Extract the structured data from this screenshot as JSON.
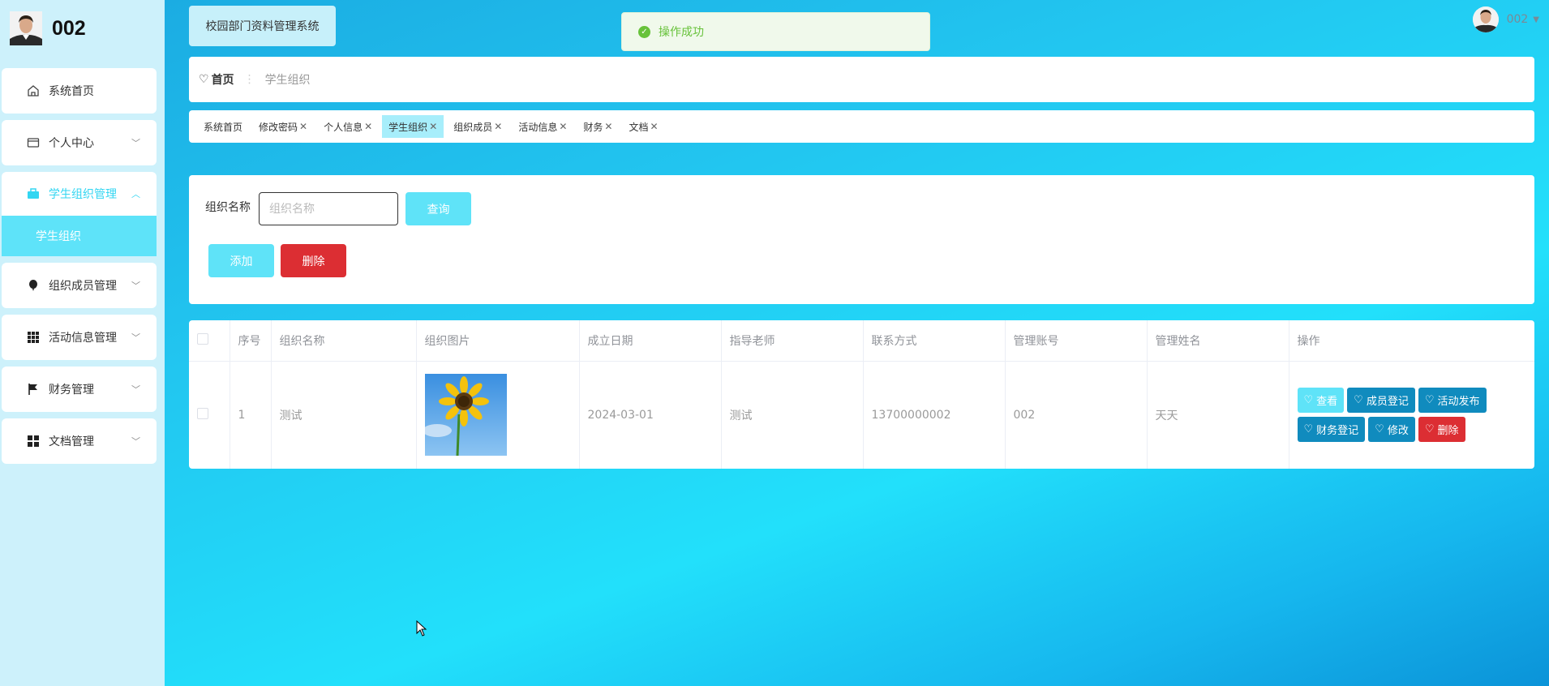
{
  "sidebar": {
    "brand": "002",
    "items": [
      {
        "label": "系统首页",
        "icon": "home-icon"
      },
      {
        "label": "个人中心",
        "icon": "card-icon"
      },
      {
        "label": "学生组织管理",
        "icon": "briefcase-icon",
        "active": true
      },
      {
        "label": "组织成员管理",
        "icon": "balloon-icon"
      },
      {
        "label": "活动信息管理",
        "icon": "grid-icon"
      },
      {
        "label": "财务管理",
        "icon": "flag-icon"
      },
      {
        "label": "文档管理",
        "icon": "apps-icon"
      }
    ],
    "submenu": "学生组织"
  },
  "header": {
    "system_title": "校园部门资料管理系统",
    "toast": "操作成功",
    "user": "002"
  },
  "breadcrumb": {
    "home": "首页",
    "current": "学生组织"
  },
  "tags": [
    {
      "label": "系统首页",
      "closable": false
    },
    {
      "label": "修改密码",
      "closable": true
    },
    {
      "label": "个人信息",
      "closable": true
    },
    {
      "label": "学生组织",
      "closable": true,
      "active": true
    },
    {
      "label": "组织成员",
      "closable": true
    },
    {
      "label": "活动信息",
      "closable": true
    },
    {
      "label": "财务",
      "closable": true
    },
    {
      "label": "文档",
      "closable": true
    }
  ],
  "search": {
    "label": "组织名称",
    "placeholder": "组织名称",
    "query_button": "查询",
    "add_button": "添加",
    "delete_button": "删除"
  },
  "table": {
    "headers": [
      "序号",
      "组织名称",
      "组织图片",
      "成立日期",
      "指导老师",
      "联系方式",
      "管理账号",
      "管理姓名",
      "操作"
    ],
    "rows": [
      {
        "index": "1",
        "name": "测试",
        "date": "2024-03-01",
        "teacher": "测试",
        "phone": "13700000002",
        "account": "002",
        "manager": "天天"
      }
    ],
    "actions": {
      "view": "查看",
      "member": "成员登记",
      "activity": "活动发布",
      "finance": "财务登记",
      "edit": "修改",
      "delete": "删除"
    }
  },
  "colors": {
    "accent": "#5fe3f8",
    "primary": "#108bbe",
    "danger": "#dc2e33",
    "success": "#67c23a"
  }
}
